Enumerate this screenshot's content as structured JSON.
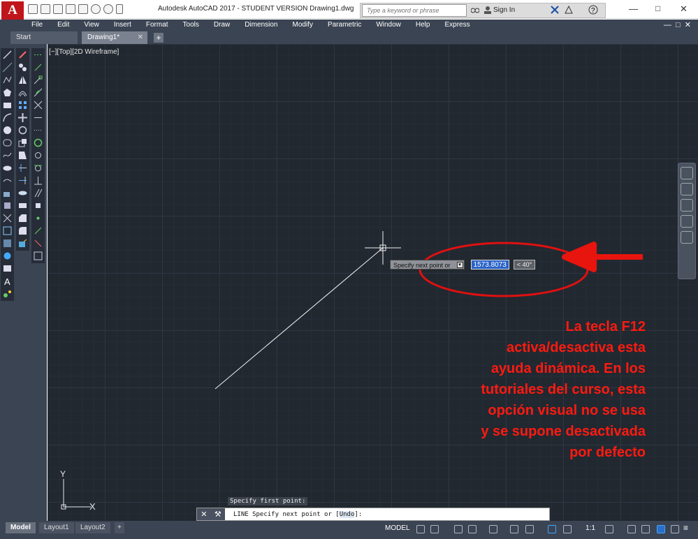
{
  "window": {
    "title": "Autodesk AutoCAD 2017 - STUDENT VERSION    Drawing1.dwg",
    "app_icon_letter": "A"
  },
  "search": {
    "placeholder": "Type a keyword or phrase"
  },
  "account": {
    "signin_label": "Sign In"
  },
  "menu": [
    "File",
    "Edit",
    "View",
    "Insert",
    "Format",
    "Tools",
    "Draw",
    "Dimension",
    "Modify",
    "Parametric",
    "Window",
    "Help",
    "Express"
  ],
  "tabs": {
    "start": "Start",
    "drawing": "Drawing1*",
    "plus": "+"
  },
  "viewport": {
    "label": "[−][Top][2D Wireframe]"
  },
  "dynamic_input": {
    "prompt": "Specify next point or",
    "length": "1573.8073",
    "angle": "< 40°"
  },
  "annotation": {
    "lines": [
      "La tecla F12",
      "activa/desactiva esta",
      "ayuda dinámica. En los",
      "tutoriales del curso, esta",
      "opción visual no se usa",
      "y se supone desactivada",
      "por defecto"
    ],
    "color": "#ff1a10"
  },
  "ucs": {
    "x_label": "X",
    "y_label": "Y"
  },
  "command": {
    "history": "Specify first point:",
    "prefix": "LINE Specify next point or [",
    "undo": "Undo",
    "suffix": "]:"
  },
  "layout_tabs": [
    "Model",
    "Layout1",
    "Layout2"
  ],
  "status": {
    "model_label": "MODEL",
    "scale": "1:1"
  },
  "colors": {
    "canvas": "#212830",
    "chrome": "#3b4453",
    "accent": "#c0151b"
  }
}
